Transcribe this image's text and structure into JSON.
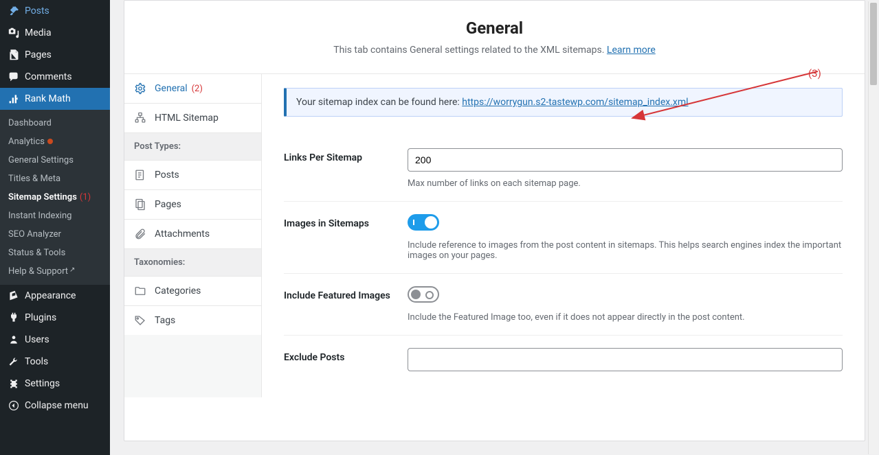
{
  "sidebar": {
    "main": [
      {
        "label": "Posts",
        "icon": "pin"
      },
      {
        "label": "Media",
        "icon": "media"
      },
      {
        "label": "Pages",
        "icon": "pages"
      },
      {
        "label": "Comments",
        "icon": "comment"
      },
      {
        "label": "Rank Math",
        "icon": "rankmath",
        "active": true
      }
    ],
    "submenu": [
      {
        "label": "Dashboard"
      },
      {
        "label": "Analytics",
        "dot": true
      },
      {
        "label": "General Settings"
      },
      {
        "label": "Titles & Meta"
      },
      {
        "label": "Sitemap Settings",
        "current": true,
        "annotation": "(1)"
      },
      {
        "label": "Instant Indexing"
      },
      {
        "label": "SEO Analyzer"
      },
      {
        "label": "Status & Tools"
      },
      {
        "label": "Help & Support",
        "ext": true
      }
    ],
    "main2": [
      {
        "label": "Appearance",
        "icon": "appearance"
      },
      {
        "label": "Plugins",
        "icon": "plugins"
      },
      {
        "label": "Users",
        "icon": "users"
      },
      {
        "label": "Tools",
        "icon": "tools"
      },
      {
        "label": "Settings",
        "icon": "settings"
      },
      {
        "label": "Collapse menu",
        "icon": "collapse"
      }
    ]
  },
  "header": {
    "title": "General",
    "desc": "This tab contains General settings related to the XML sitemaps. ",
    "learn_more": "Learn more"
  },
  "tabs": {
    "general": {
      "label": "General",
      "annotation": "(2)"
    },
    "html": {
      "label": "HTML Sitemap"
    },
    "section_post_types": "Post Types:",
    "posts": {
      "label": "Posts"
    },
    "pages": {
      "label": "Pages"
    },
    "attachments": {
      "label": "Attachments"
    },
    "section_tax": "Taxonomies:",
    "categories": {
      "label": "Categories"
    },
    "tags": {
      "label": "Tags"
    }
  },
  "notice": {
    "prefix": "Your sitemap index can be found here: ",
    "url": "https://worrygun.s2-tastewp.com/sitemap_index.xml"
  },
  "fields": {
    "links_per_sitemap": {
      "label": "Links Per Sitemap",
      "value": "200",
      "desc": "Max number of links on each sitemap page."
    },
    "images_in_sitemaps": {
      "label": "Images in Sitemaps",
      "on": true,
      "desc": "Include reference to images from the post content in sitemaps. This helps search engines index the important images on your pages."
    },
    "featured_images": {
      "label": "Include Featured Images",
      "on": false,
      "desc": "Include the Featured Image too, even if it does not appear directly in the post content."
    },
    "exclude_posts": {
      "label": "Exclude Posts",
      "value": ""
    }
  },
  "annotations": {
    "arrow_label": "(3)"
  }
}
